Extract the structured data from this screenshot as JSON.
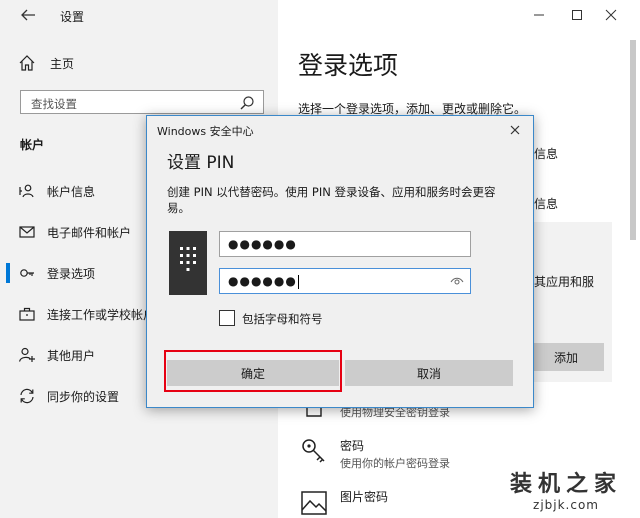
{
  "window": {
    "title": "设置",
    "controls": [
      "minimize",
      "maximize",
      "close"
    ]
  },
  "sidebar": {
    "home_label": "主页",
    "search_placeholder": "查找设置",
    "section_title": "帐户",
    "items": [
      {
        "label": "帐户信息",
        "icon": "person-card-icon"
      },
      {
        "label": "电子邮件和帐户",
        "icon": "mail-icon"
      },
      {
        "label": "登录选项",
        "icon": "key-icon",
        "selected": true
      },
      {
        "label": "连接工作或学校帐户",
        "icon": "briefcase-icon"
      },
      {
        "label": "其他用户",
        "icon": "person-add-icon"
      },
      {
        "label": "同步你的设置",
        "icon": "sync-icon"
      }
    ]
  },
  "content": {
    "title": "登录选项",
    "description": "选择一个登录选项，添加、更改或删除它。",
    "peek_1": "信息",
    "peek_2": "信息",
    "peek_3": "其应用和服",
    "add_button": "添加",
    "option_security_key_sub": "使用物理安全密钥登录",
    "option_password_title": "密码",
    "option_password_sub": "使用你的帐户密码登录",
    "option_picture_title": "图片密码"
  },
  "dialog": {
    "app_title": "Windows 安全中心",
    "heading": "设置 PIN",
    "description": "创建 PIN 以代替密码。使用 PIN 登录设备、应用和服务时会更容易。",
    "pin_1": "●●●●●●",
    "pin_2": "●●●●●●",
    "checkbox_label": "包括字母和符号",
    "checkbox_checked": false,
    "ok_label": "确定",
    "cancel_label": "取消",
    "highlight_color": "#e60012"
  },
  "watermark": {
    "line1": "装机之家",
    "line2": "zjbjk.com"
  },
  "colors": {
    "accent": "#0078d7",
    "sidebar_bg": "#f2f2f2",
    "dialog_bg": "#f0f0f0"
  }
}
